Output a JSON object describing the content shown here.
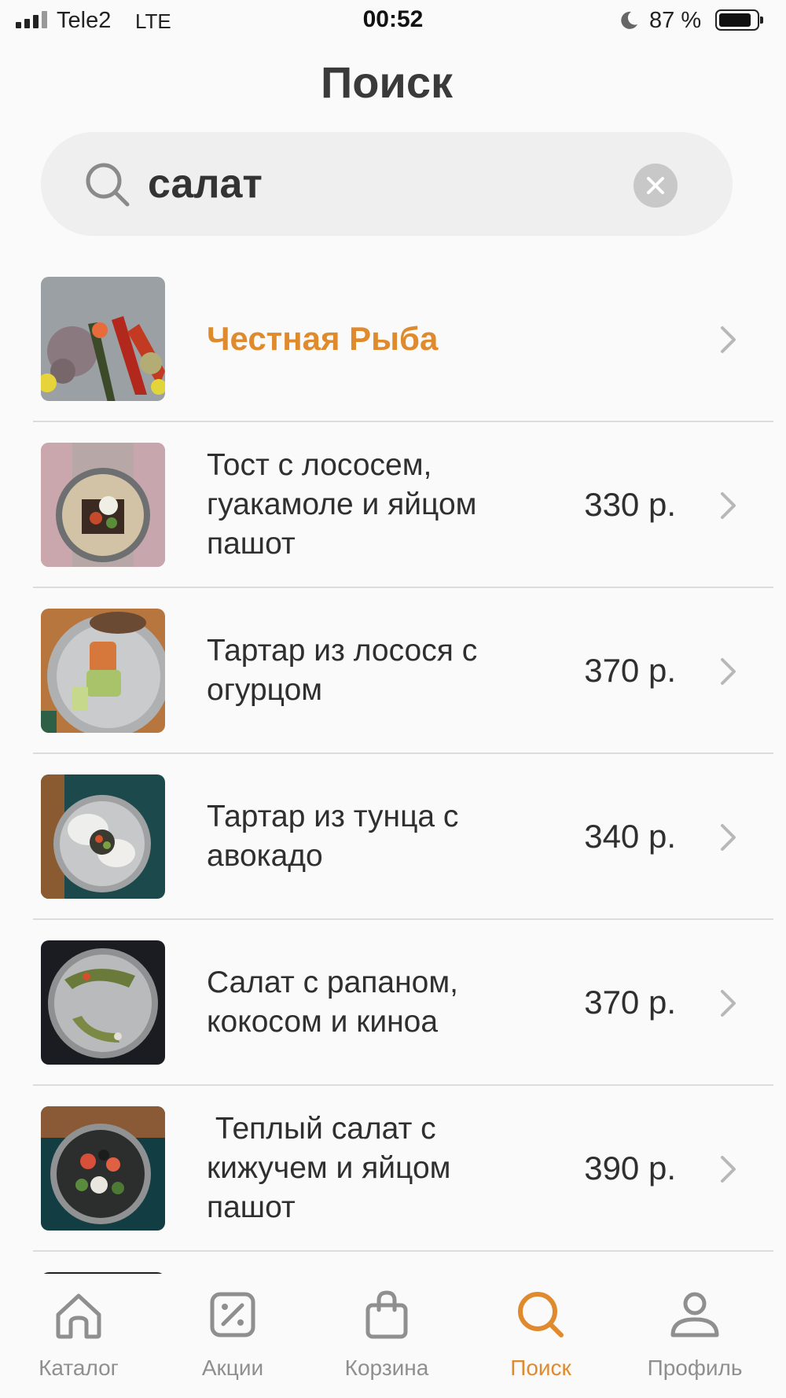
{
  "status_bar": {
    "carrier": "Tele2",
    "network": "LTE",
    "time": "00:52",
    "battery_percent": "87 %",
    "battery_level": 0.87
  },
  "header": {
    "title": "Поиск"
  },
  "search": {
    "value": "салат",
    "placeholder": ""
  },
  "colors": {
    "accent": "#e08a2e",
    "text": "#333333",
    "muted": "#8f8f8f"
  },
  "results": [
    {
      "name": "Честная Рыба",
      "price": "",
      "kind": "store"
    },
    {
      "name": "Тост с лососем, гуакамоле и яйцом пашот",
      "price": "330 р.",
      "kind": "dish"
    },
    {
      "name": "Тартар из лосося с огурцом",
      "price": "370 р.",
      "kind": "dish"
    },
    {
      "name": "Тартар из тунца с авокадо",
      "price": "340 р.",
      "kind": "dish"
    },
    {
      "name": "Салат с рапаном, кокосом и киноа",
      "price": "370 р.",
      "kind": "dish"
    },
    {
      "name": " Теплый салат с кижучем и яйцом пашот",
      "price": "390 р.",
      "kind": "dish"
    }
  ],
  "tab_bar": {
    "tabs": [
      {
        "label": "Каталог",
        "icon": "home-icon"
      },
      {
        "label": "Акции",
        "icon": "discount-icon"
      },
      {
        "label": "Корзина",
        "icon": "bag-icon"
      },
      {
        "label": "Поиск",
        "icon": "search-icon"
      },
      {
        "label": "Профиль",
        "icon": "profile-icon"
      }
    ],
    "active": "Поиск"
  }
}
